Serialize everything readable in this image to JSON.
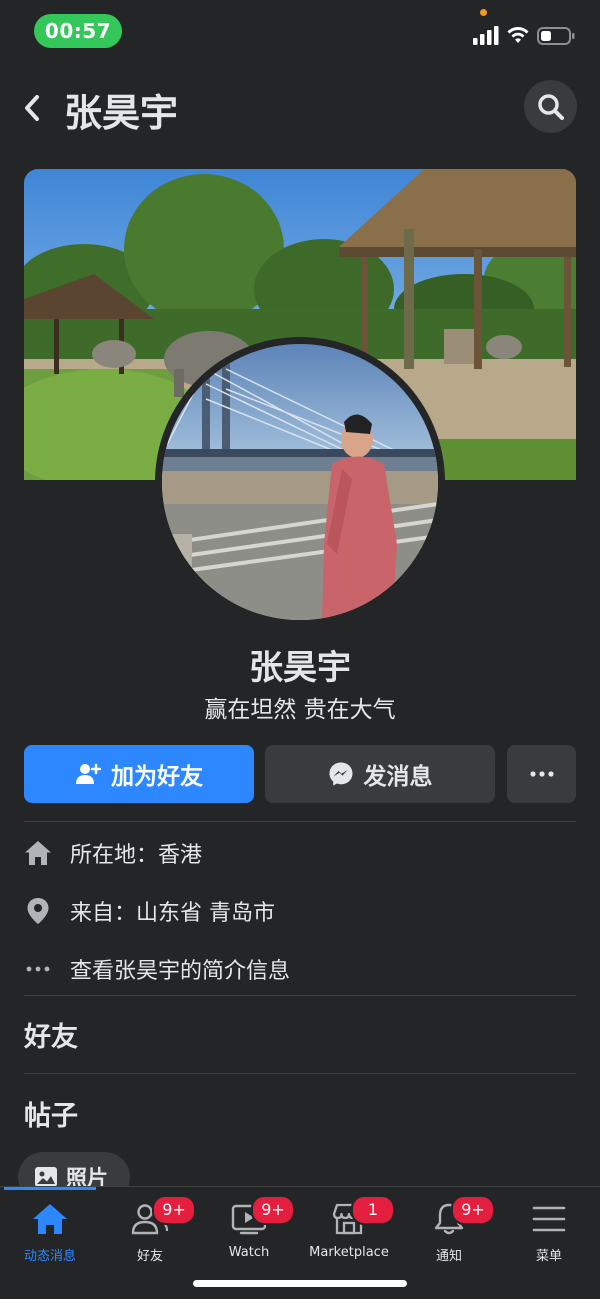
{
  "status_bar": {
    "time": "00:57"
  },
  "header": {
    "title": "张昊宇"
  },
  "profile": {
    "name": "张昊宇",
    "bio": "赢在坦然 贵在大气"
  },
  "actions": {
    "add_friend": "加为好友",
    "message": "发消息"
  },
  "info": {
    "lives_in": "所在地：香港",
    "from": "来自：山东省 青岛市",
    "about": "查看张昊宇的简介信息"
  },
  "sections": {
    "friends": "好友",
    "posts": "帖子"
  },
  "photos_chip": "照片",
  "tabs": [
    {
      "label": "动态消息",
      "icon": "home-icon",
      "badge": ""
    },
    {
      "label": "好友",
      "icon": "friends-icon",
      "badge": "9+"
    },
    {
      "label": "Watch",
      "icon": "watch-icon",
      "badge": "9+"
    },
    {
      "label": "Marketplace",
      "icon": "marketplace-icon",
      "badge": "1"
    },
    {
      "label": "通知",
      "icon": "bell-icon",
      "badge": "9+"
    },
    {
      "label": "菜单",
      "icon": "menu-icon",
      "badge": ""
    }
  ],
  "colors": {
    "accent": "#2d88ff",
    "badge": "#e41e3f",
    "background": "#242526",
    "surface": "#3a3b3c"
  }
}
